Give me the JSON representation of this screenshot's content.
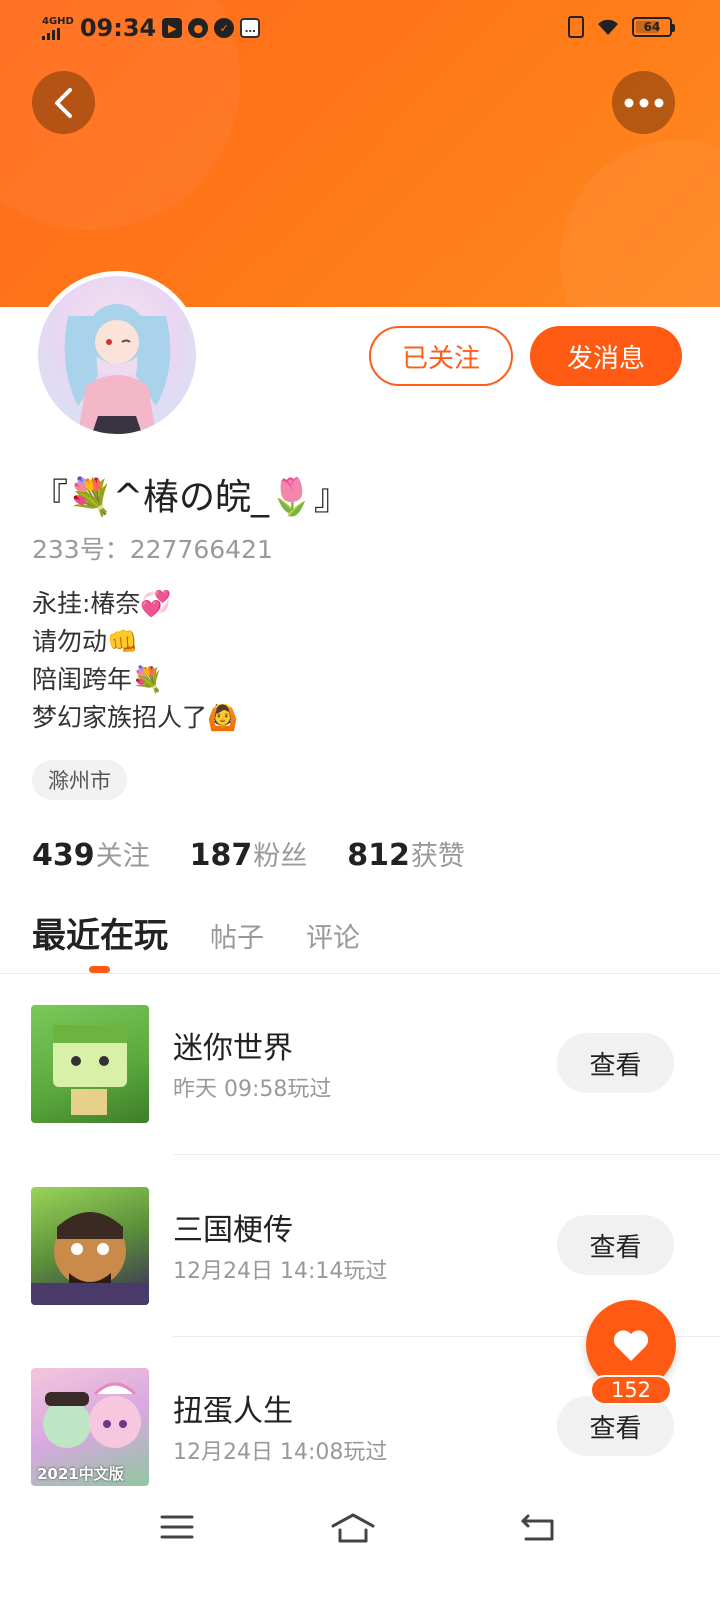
{
  "status_bar": {
    "network": "4GHD",
    "time": "09:34",
    "battery": "64"
  },
  "header": {
    "accent_color": "#ff6a1a"
  },
  "actions": {
    "follow_label": "已关注",
    "message_label": "发消息"
  },
  "profile": {
    "username": "『💐^椿の皖_🌷』",
    "id_text": "233号：227766421",
    "bio": [
      "永挂:椿奈💞",
      "请勿动👊",
      "陪闺跨年💐",
      "梦幻家族招人了🙆"
    ],
    "location": "滁州市"
  },
  "stats": [
    {
      "num": "439",
      "label": "关注"
    },
    {
      "num": "187",
      "label": "粉丝"
    },
    {
      "num": "812",
      "label": "获赞"
    }
  ],
  "tabs": [
    "最近在玩",
    "帖子",
    "评论"
  ],
  "games": [
    {
      "name": "迷你世界",
      "time": "昨天 09:58玩过",
      "button": "查看"
    },
    {
      "name": "三国梗传",
      "time": "12月24日 14:14玩过",
      "button": "查看"
    },
    {
      "name": "扭蛋人生",
      "time": "12月24日 14:08玩过",
      "button": "查看",
      "thumb_text": "2021中文版"
    }
  ],
  "like": {
    "count": "152"
  }
}
